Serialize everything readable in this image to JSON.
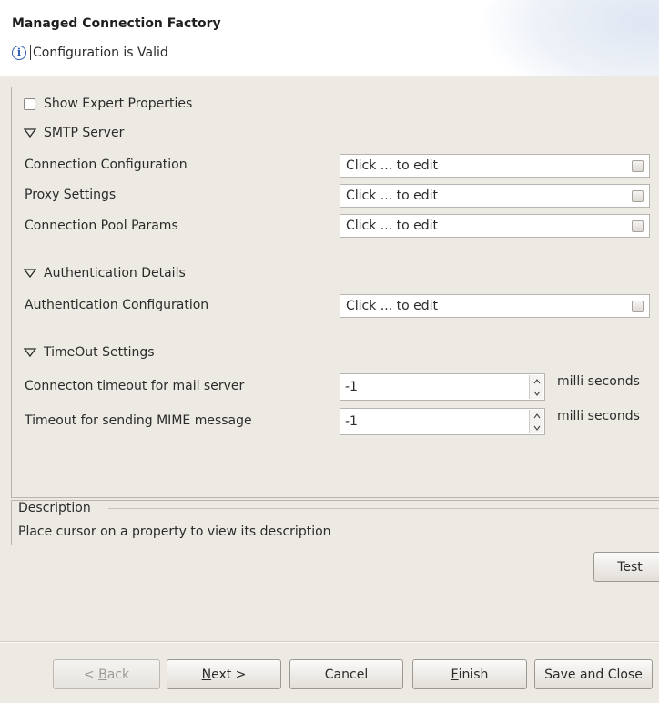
{
  "header": {
    "title": "Managed Connection Factory",
    "status": "Configuration is Valid",
    "status_icon": "info-icon"
  },
  "options": {
    "show_expert_label": "Show Expert Properties",
    "show_expert_checked": false
  },
  "sections": {
    "smtp": {
      "title": "SMTP Server",
      "expanded": true,
      "props": [
        {
          "label": "Connection Configuration",
          "value": "Click ... to edit"
        },
        {
          "label": "Proxy Settings",
          "value": "Click ... to edit"
        },
        {
          "label": "Connection Pool Params",
          "value": "Click ... to edit"
        }
      ]
    },
    "auth": {
      "title": "Authentication Details",
      "expanded": true,
      "props": [
        {
          "label": "Authentication Configuration",
          "value": "Click ... to edit"
        }
      ]
    },
    "timeout": {
      "title": "TimeOut Settings",
      "expanded": true,
      "props": [
        {
          "label": "Connecton timeout for mail server",
          "value": "-1",
          "unit": "milli seconds"
        },
        {
          "label": "Timeout for sending MIME message",
          "value": "-1",
          "unit": "milli seconds"
        }
      ]
    }
  },
  "description": {
    "heading": "Description",
    "text": "Place cursor on a property to view its description"
  },
  "buttons": {
    "test": "Test",
    "back_prefix": "< ",
    "back_mnemonic": "B",
    "back_rest": "ack",
    "next_mnemonic": "N",
    "next_rest": "ext >",
    "cancel": "Cancel",
    "finish_mnemonic": "F",
    "finish_rest": "inish",
    "save_close": "Save and Close"
  },
  "colors": {
    "background": "#ede9e3",
    "info_blue": "#2a5db0"
  }
}
